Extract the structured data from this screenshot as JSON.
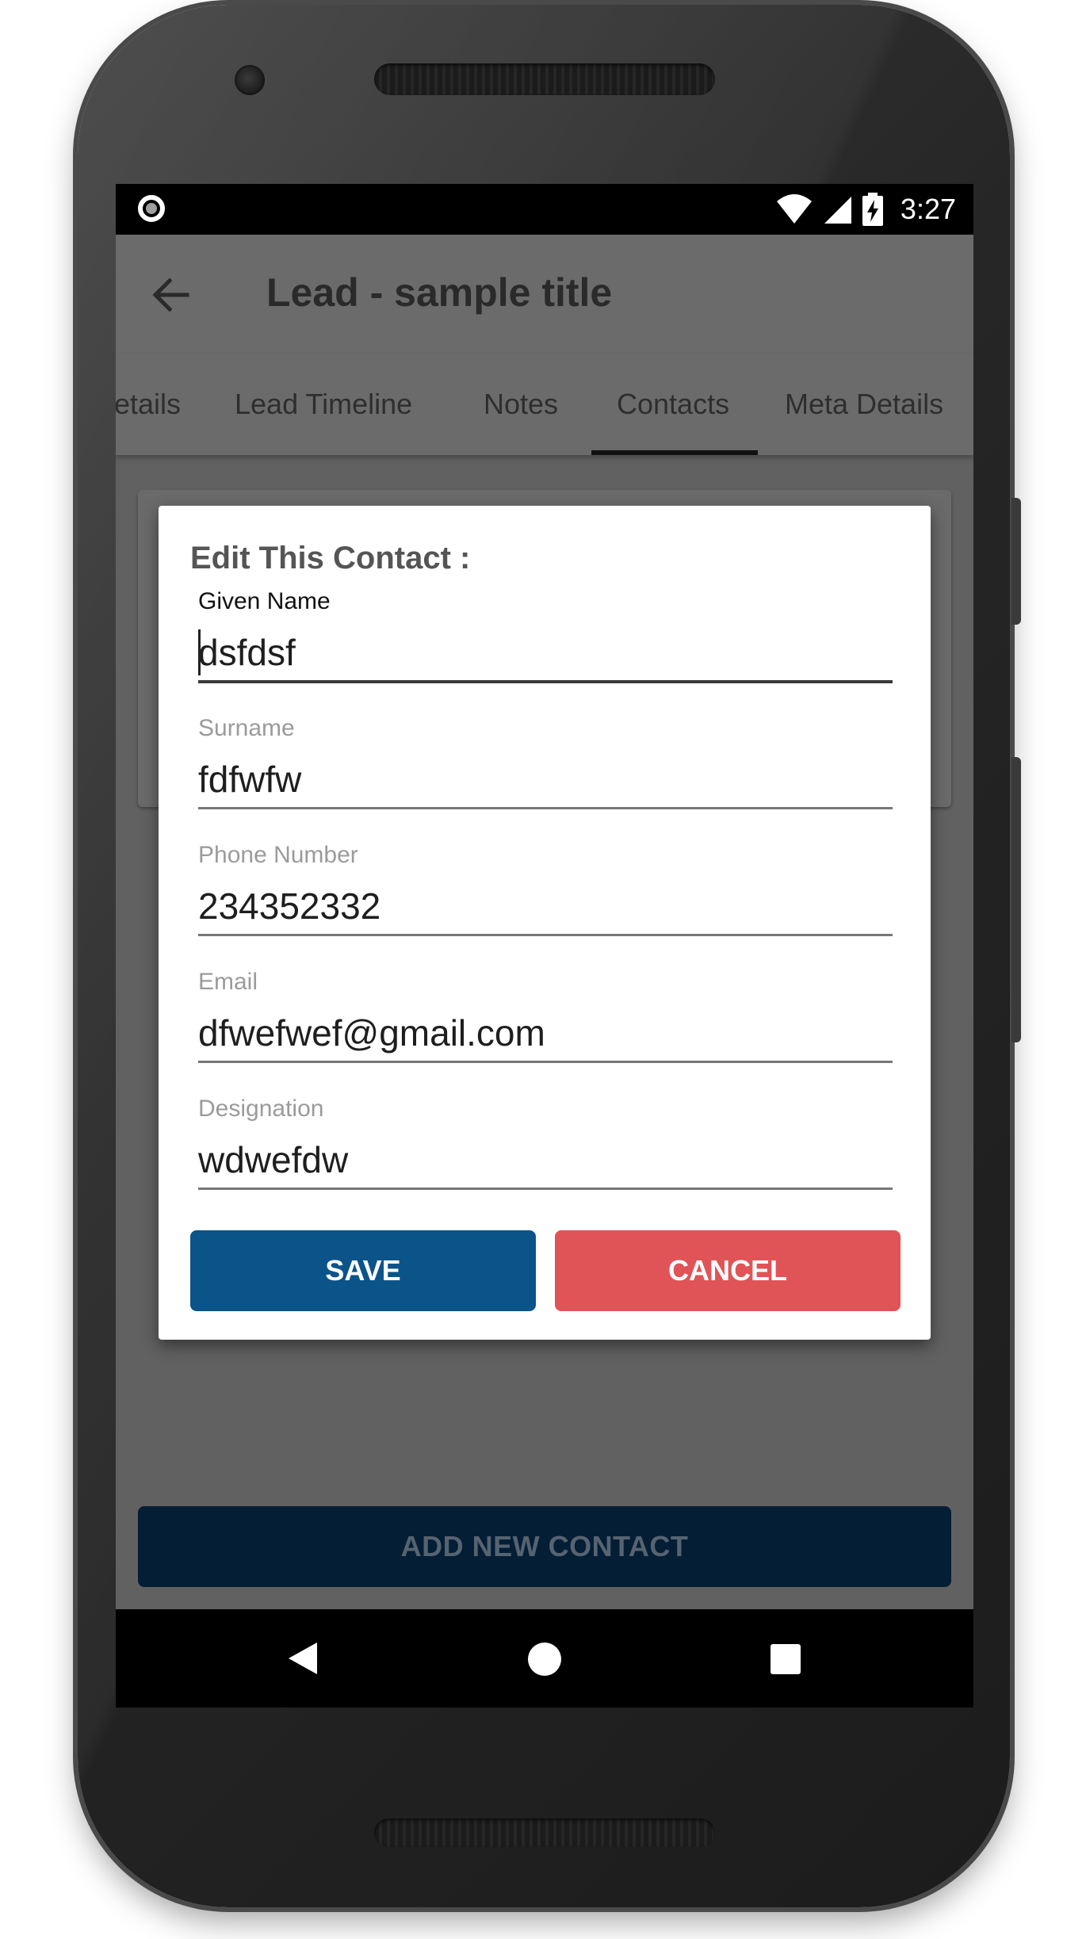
{
  "status_bar": {
    "time": "3:27"
  },
  "toolbar": {
    "title": "Lead - sample title"
  },
  "tabs": [
    {
      "label": "etails"
    },
    {
      "label": "Lead Timeline"
    },
    {
      "label": "Notes"
    },
    {
      "label": "Contacts",
      "selected": true
    },
    {
      "label": "Meta Details"
    }
  ],
  "dialog": {
    "title": "Edit This Contact :",
    "fields": {
      "given_name": {
        "label": "Given Name",
        "value": "dsfdsf"
      },
      "surname": {
        "label": "Surname",
        "value": "fdfwfw"
      },
      "phone": {
        "label": "Phone Number",
        "value": "234352332"
      },
      "email": {
        "label": "Email",
        "value": "dfwefwef@gmail.com"
      },
      "designation": {
        "label": "Designation",
        "value": "wdwefdw"
      }
    },
    "save_label": "SAVE",
    "cancel_label": "CANCEL"
  },
  "add_contact_label": "ADD NEW CONTACT",
  "colors": {
    "save": "#0b548a",
    "cancel": "#e05457",
    "add_contact": "#041e36"
  },
  "icons": {
    "back": "arrow-left-icon",
    "wifi": "wifi-icon",
    "signal": "cell-signal-icon",
    "battery": "battery-charging-icon"
  }
}
